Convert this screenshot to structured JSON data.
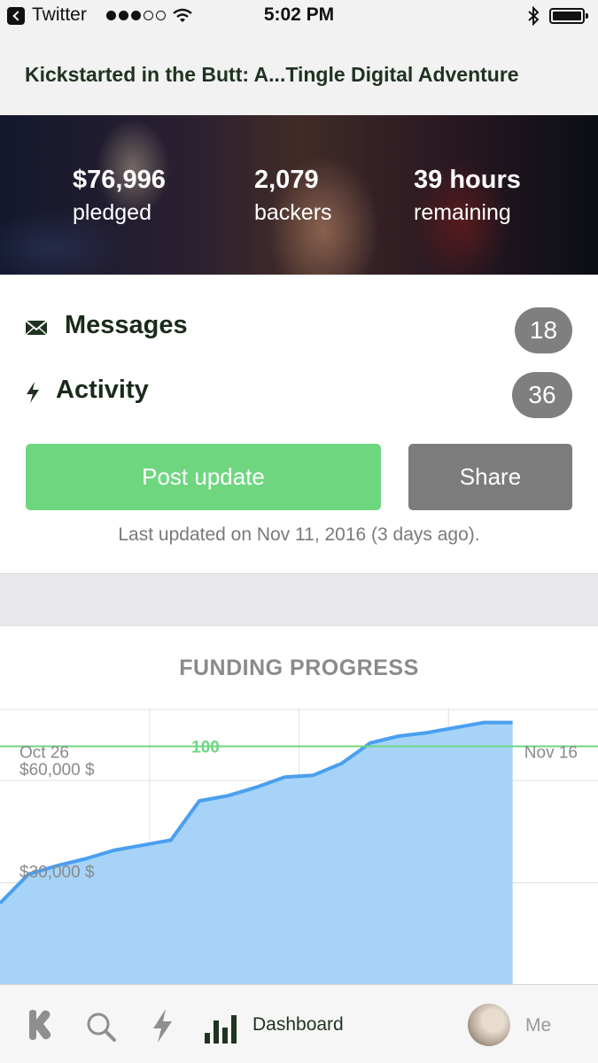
{
  "status_bar": {
    "back_app": "Twitter",
    "time": "5:02 PM",
    "signal_dots_on": 3,
    "signal_dots_total": 5
  },
  "project": {
    "title": "Kickstarted in the Butt: A...Tingle Digital Adventure"
  },
  "stats": [
    {
      "value": "$76,996",
      "label": "pledged"
    },
    {
      "value": "2,079",
      "label": "backers"
    },
    {
      "value": "39 hours",
      "label": "remaining"
    }
  ],
  "menu": {
    "messages": {
      "label": "Messages",
      "count": "18",
      "icon": "envelope-icon"
    },
    "activity": {
      "label": "Activity",
      "count": "36",
      "icon": "lightning-icon"
    }
  },
  "actions": {
    "post_update": "Post update",
    "share": "Share",
    "last_updated": "Last updated on Nov 11, 2016 (3 days ago)."
  },
  "colors": {
    "accent_green": "#6fd680",
    "goal_line": "#6fd680",
    "area_fill": "#a6d3f7",
    "area_line": "#4a9ff0",
    "badge_gray": "#7f7f7f"
  },
  "chart_data": {
    "type": "area",
    "title": "FUNDING PROGRESS",
    "x_start_label": "Oct 26",
    "x_end_label": "Nov 16",
    "goal_label": "100",
    "y_tick_labels": [
      "$60,000 $",
      "$30,000 $"
    ],
    "y_ticks": [
      60000,
      30000
    ],
    "goal_value": 70000,
    "ylim": [
      0,
      80000
    ],
    "x_days": [
      0,
      1,
      2,
      3,
      4,
      5,
      6,
      7,
      8,
      9,
      10,
      11,
      12,
      13,
      14,
      15,
      16,
      17,
      18
    ],
    "values": [
      24000,
      32500,
      35000,
      37000,
      39500,
      41000,
      42500,
      54000,
      55500,
      58000,
      61000,
      61500,
      65000,
      71000,
      73000,
      74000,
      75500,
      76996,
      76996
    ],
    "xlim": [
      0,
      21
    ],
    "grid": true
  },
  "tab_bar": {
    "dashboard_label": "Dashboard",
    "me_label": "Me"
  }
}
